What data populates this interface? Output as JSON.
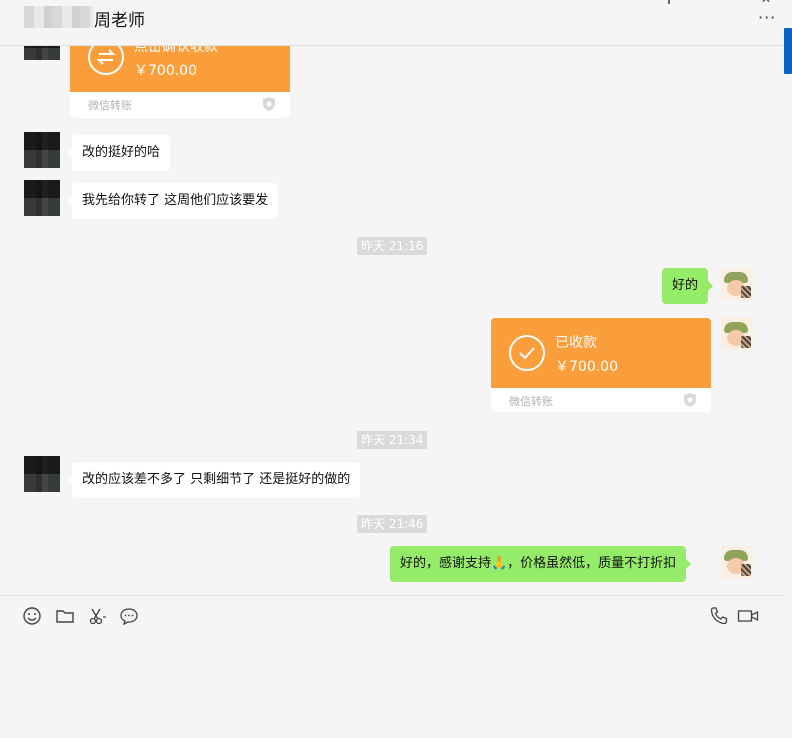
{
  "header": {
    "contact_name": "周老师"
  },
  "messages": {
    "transfer_received": {
      "status": "点击确认收款",
      "amount": "￥700.00",
      "label": "微信转账"
    },
    "msg1": "改的挺好的哈",
    "msg2": "我先给你转了 这周他们应该要发",
    "time1": "昨天 21:16",
    "msg3": "好的",
    "transfer_sent": {
      "status": "已收款",
      "amount": "￥700.00",
      "label": "微信转账"
    },
    "time2": "昨天 21:34",
    "msg4": "改的应该差不多了 只剩细节了 还是挺好的做的",
    "time3": "昨天 21:46",
    "msg5": "好的，感谢支持🙏，价格虽然低，质量不打折扣"
  },
  "colors": {
    "transfer_orange": "#fa9d3b",
    "bubble_green": "#95ec69",
    "accent_blue": "#0a63c4"
  }
}
